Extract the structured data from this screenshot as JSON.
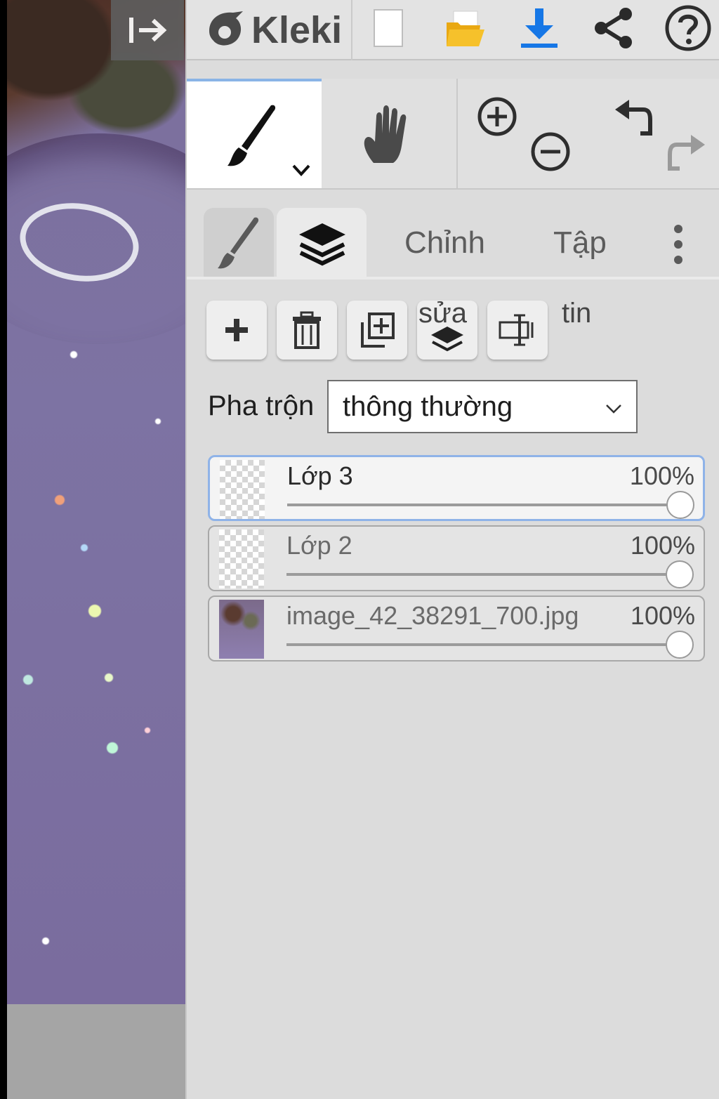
{
  "app": {
    "name": "Kleki",
    "colors": {
      "panel_bg": "#dcdcdc",
      "accent_blue": "#1677e6",
      "active_tab_border": "#8ab4e6",
      "folder_yellow": "#f2b81a"
    }
  },
  "topbar": {
    "collapse_icon": "collapse-panel-icon",
    "logo_text": "Kleki",
    "icons": [
      "new-document-icon",
      "open-folder-icon",
      "download-icon",
      "share-icon",
      "help-icon"
    ]
  },
  "tools": {
    "brush": "brush-icon",
    "hand": "hand-icon",
    "zoom_in": "zoom-in-icon",
    "zoom_out": "zoom-out-icon",
    "undo": "undo-icon",
    "redo": "redo-icon"
  },
  "tabs": {
    "brush_icon": "brush-tab-icon",
    "layers_icon": "layers-tab-icon",
    "edit_label": "Chỉnh",
    "file_label": "Tập",
    "more_icon": "more-vertical-icon"
  },
  "layer_toolbar": {
    "icons": [
      "add-layer-icon",
      "delete-layer-icon",
      "duplicate-layer-icon",
      "merge-down-icon",
      "rename-layer-icon"
    ],
    "overflow_text_1": "sửa",
    "overflow_text_2": "tin"
  },
  "blend": {
    "label": "Pha trộn",
    "value": "thông thường"
  },
  "layers": [
    {
      "name": "Lớp 3",
      "opacity": "100%",
      "opacity_value": 1.0,
      "active": true
    },
    {
      "name": "Lớp 2",
      "opacity": "100%",
      "opacity_value": 1.0,
      "active": false
    },
    {
      "name": "image_42_38291_700.jpg",
      "opacity": "100%",
      "opacity_value": 1.0,
      "active": false
    }
  ]
}
